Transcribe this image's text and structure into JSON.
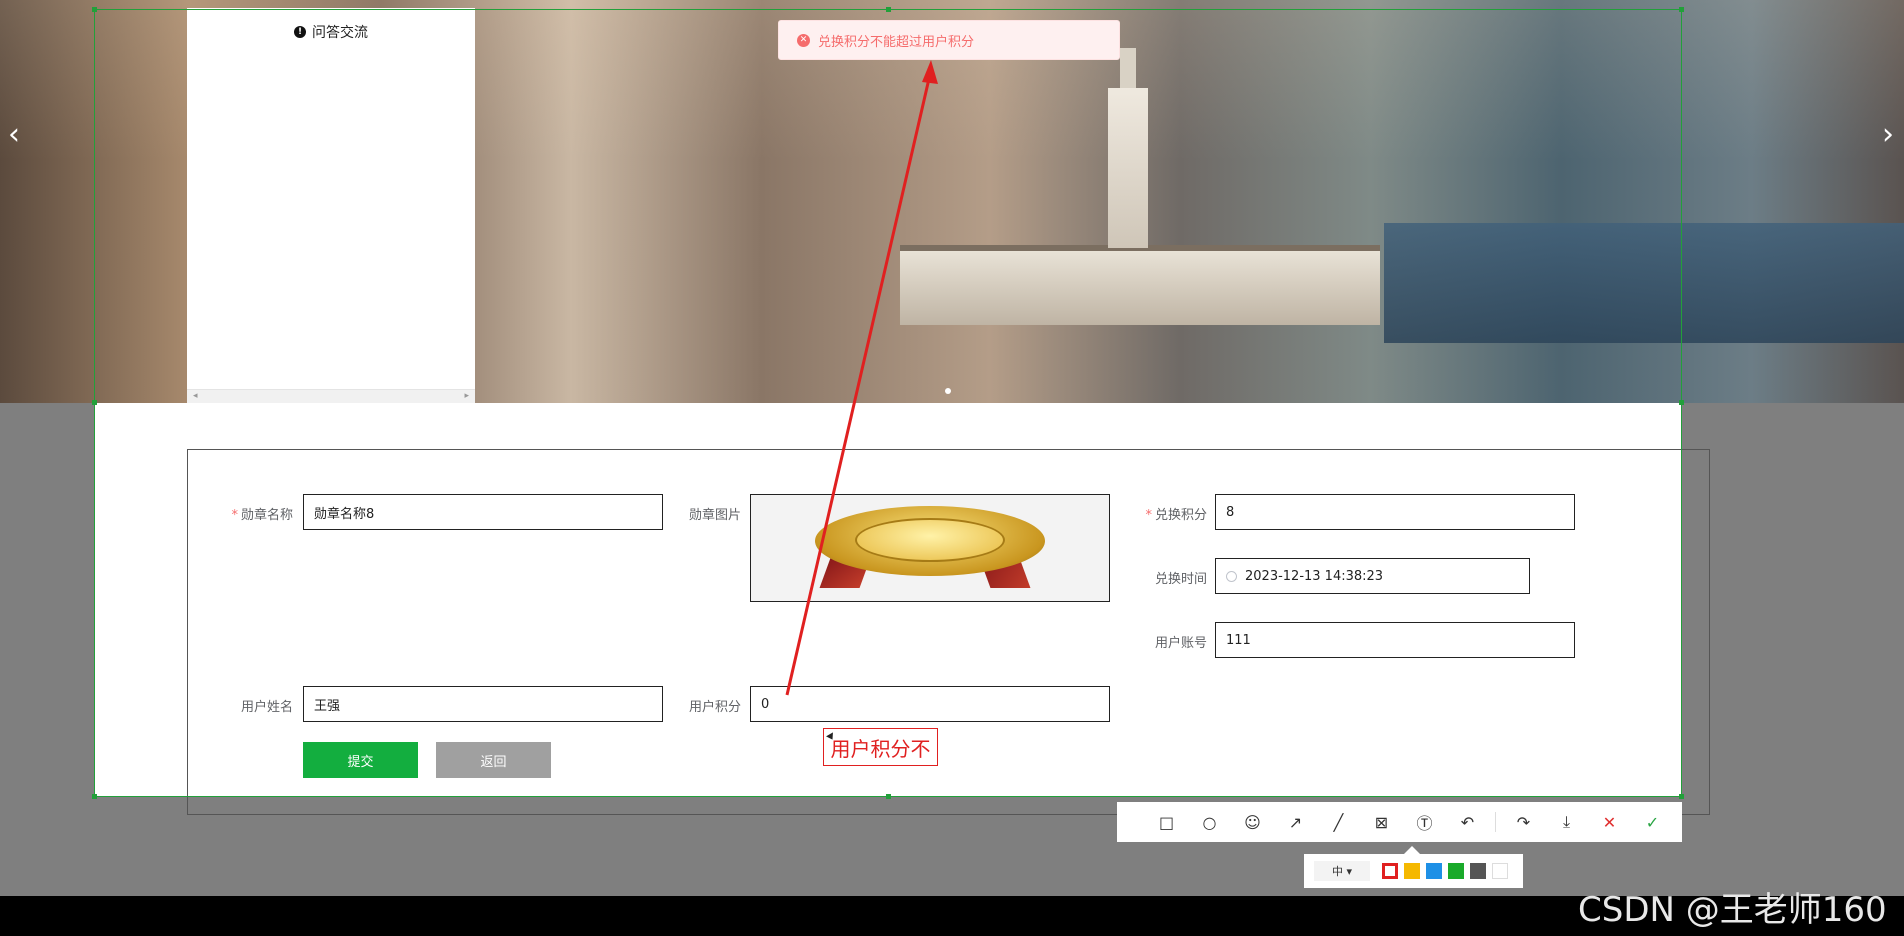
{
  "side_menu": {
    "item_label": "问答交流"
  },
  "toast": {
    "message": "兑换积分不能超过用户积分"
  },
  "form": {
    "badge_name": {
      "label": "勋章名称",
      "value": "勋章名称8"
    },
    "badge_image": {
      "label": "勋章图片"
    },
    "exchange_points": {
      "label": "兑换积分",
      "value": "8"
    },
    "exchange_time": {
      "label": "兑换时间",
      "value": "2023-12-13 14:38:23"
    },
    "user_account": {
      "label": "用户账号",
      "value": "111"
    },
    "user_name": {
      "label": "用户姓名",
      "value": "王强"
    },
    "user_points": {
      "label": "用户积分",
      "value": "0"
    },
    "submit_label": "提交",
    "back_label": "返回"
  },
  "annotation": {
    "text": "用户积分不"
  },
  "toolbar": {
    "size_label": "中 ▾",
    "tools": [
      "rectangle-icon",
      "ellipse-icon",
      "emoji-icon",
      "arrow-icon",
      "line-icon",
      "mosaic-icon",
      "text-icon",
      "undo-icon",
      "share-icon",
      "download-icon",
      "cancel-icon",
      "confirm-icon"
    ],
    "colors": [
      "#e02020",
      "#f5b800",
      "#1e90e6",
      "#1aaa2a",
      "#555555",
      "#ffffff"
    ]
  },
  "watermark": "CSDN @王老师160",
  "colors": {
    "accent_green": "#13ae3f",
    "error_red": "#f56c6c",
    "annotation_red": "#e02020",
    "selection_green": "#22a03a"
  }
}
